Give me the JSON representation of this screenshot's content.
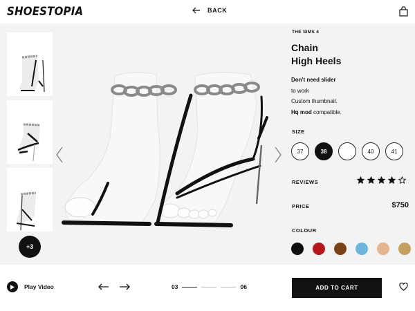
{
  "header": {
    "logo": "SHOESTOPIA",
    "back_label": "BACK"
  },
  "gallery": {
    "thumbnails": [
      "thumbnail-1",
      "thumbnail-2",
      "thumbnail-3"
    ],
    "more_label": "+3"
  },
  "product": {
    "brand": "THE SIMS 4",
    "title_line1": "Chain",
    "title_line2": "High Heels",
    "desc_line1": "Don't need slider",
    "desc_line2": "to work",
    "desc_line3": "Custom thumbnail.",
    "desc_line4_bold": "Hq mod",
    "desc_line4_rest": " compatible."
  },
  "size": {
    "label": "SIZE",
    "options": [
      "37",
      "38",
      "",
      "40",
      "41"
    ],
    "selected": "38"
  },
  "reviews": {
    "label": "REVIEWS",
    "rating": 4,
    "max": 5
  },
  "price": {
    "label": "PRICE",
    "value": "$750"
  },
  "colour": {
    "label": "COLOUR",
    "swatches": [
      "#0f0f0f",
      "#b3191c",
      "#7a4018",
      "#6cb6db",
      "#e6b48e",
      "#c3a061"
    ]
  },
  "footer": {
    "play_label": "Play Video",
    "page_current": "03",
    "page_total": "06",
    "add_to_cart": "ADD TO CART"
  }
}
